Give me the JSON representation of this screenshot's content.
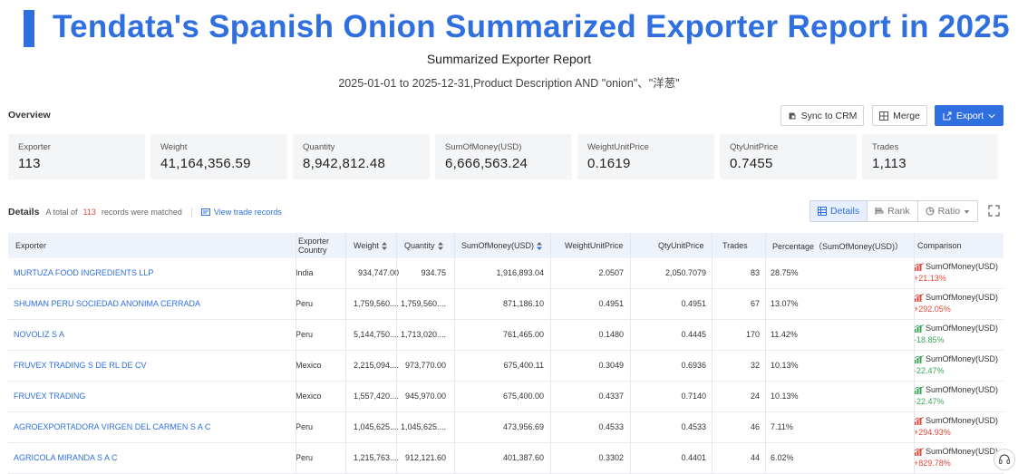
{
  "banner": {
    "title": "Tendata's Spanish Onion Summarized Exporter Report in 2025"
  },
  "report": {
    "title": "Summarized Exporter Report",
    "subtitle": "2025-01-01 to 2025-12-31,Product Description AND \"onion\"、\"洋葱\""
  },
  "overview": {
    "label": "Overview",
    "buttons": {
      "sync": "Sync to CRM",
      "merge": "Merge",
      "export": "Export"
    },
    "cards": [
      {
        "label": "Exporter",
        "value": "113"
      },
      {
        "label": "Weight",
        "value": "41,164,356.59"
      },
      {
        "label": "Quantity",
        "value": "8,942,812.48"
      },
      {
        "label": "SumOfMoney(USD)",
        "value": "6,666,563.24"
      },
      {
        "label": "WeightUnitPrice",
        "value": "0.1619"
      },
      {
        "label": "QtyUnitPrice",
        "value": "0.7455"
      },
      {
        "label": "Trades",
        "value": "1,113"
      }
    ]
  },
  "details": {
    "label": "Details",
    "total_prefix": "A total of",
    "total_count": "113",
    "total_suffix": "records were matched",
    "view_link": "View trade records",
    "views": {
      "details": "Details",
      "rank": "Rank",
      "ratio": "Ratio"
    }
  },
  "table": {
    "headers": {
      "exporter": "Exporter",
      "country_1": "Exporter",
      "country_2": "Country",
      "weight": "Weight",
      "quantity": "Quantity",
      "money": "SumOfMoney(USD)",
      "wup": "WeightUnitPrice",
      "qup": "QtyUnitPrice",
      "trades": "Trades",
      "percentage": "Percentage（SumOfMoney(USD)）",
      "comparison": "Comparison"
    },
    "comparison_label": "SumOfMoney(USD)",
    "rows": [
      {
        "exporter": "MURTUZA FOOD INGREDIENTS LLP",
        "country": "India",
        "weight": "934,747.00",
        "quantity": "934.75",
        "money": "1,916,893.04",
        "wup": "2.0507",
        "qup": "2,050.7079",
        "trades": "83",
        "percentage": "28.75%",
        "change": "+21.13%",
        "dir": "up"
      },
      {
        "exporter": "SHUMAN PERU SOCIEDAD ANONIMA CERRADA",
        "country": "Peru",
        "weight": "1,759,560....",
        "quantity": "1,759,560....",
        "money": "871,186.10",
        "wup": "0.4951",
        "qup": "0.4951",
        "trades": "67",
        "percentage": "13.07%",
        "change": "+292.05%",
        "dir": "up"
      },
      {
        "exporter": "NOVOLIZ S A",
        "country": "Peru",
        "weight": "5,144,750....",
        "quantity": "1,713,020....",
        "money": "761,465.00",
        "wup": "0.1480",
        "qup": "0.4445",
        "trades": "170",
        "percentage": "11.42%",
        "change": "-18.85%",
        "dir": "down"
      },
      {
        "exporter": "FRUVEX TRADING S DE RL DE CV",
        "country": "Mexico",
        "weight": "2,215,094....",
        "quantity": "973,770.00",
        "money": "675,400.11",
        "wup": "0.3049",
        "qup": "0.6936",
        "trades": "32",
        "percentage": "10.13%",
        "change": "-22.47%",
        "dir": "down"
      },
      {
        "exporter": "FRUVEX TRADING",
        "country": "Mexico",
        "weight": "1,557,420....",
        "quantity": "945,970.00",
        "money": "675,400.00",
        "wup": "0.4337",
        "qup": "0.7140",
        "trades": "24",
        "percentage": "10.13%",
        "change": "-22.47%",
        "dir": "down"
      },
      {
        "exporter": "AGROEXPORTADORA VIRGEN DEL CARMEN S A C",
        "country": "Peru",
        "weight": "1,045,625....",
        "quantity": "1,045,625....",
        "money": "473,956.69",
        "wup": "0.4533",
        "qup": "0.4533",
        "trades": "46",
        "percentage": "7.11%",
        "change": "+294.93%",
        "dir": "up"
      },
      {
        "exporter": "AGRICOLA MIRANDA S A C",
        "country": "Peru",
        "weight": "1,215,763....",
        "quantity": "912,121.60",
        "money": "401,387.60",
        "wup": "0.3302",
        "qup": "0.4401",
        "trades": "44",
        "percentage": "6.02%",
        "change": "+829.78%",
        "dir": "up"
      }
    ]
  },
  "colors": {
    "accent": "#2f6fe0",
    "up": "#e0483b",
    "down": "#3aa757"
  }
}
